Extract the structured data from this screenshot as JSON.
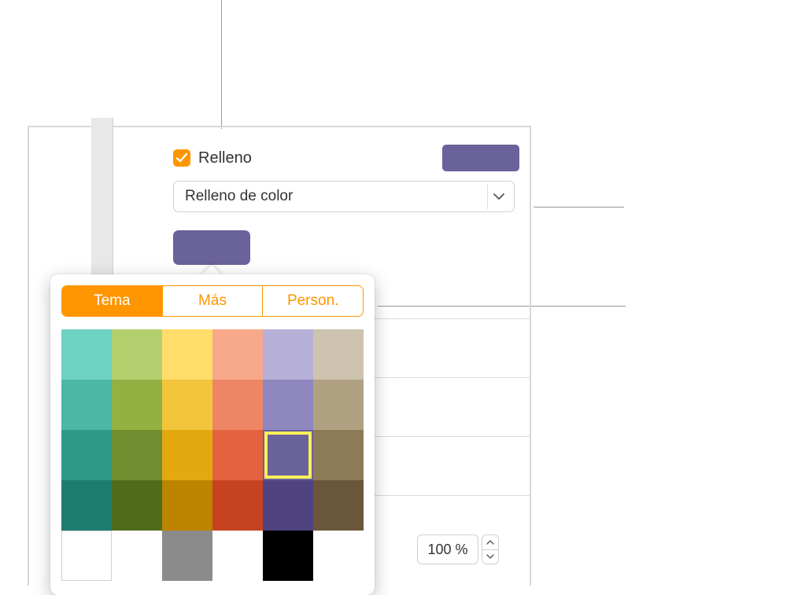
{
  "fill": {
    "checkbox_checked": true,
    "label": "Relleno",
    "preview_color": "#6a629a"
  },
  "dropdown": {
    "selected": "Relleno de color"
  },
  "color_well": {
    "color": "#6a629a"
  },
  "popover": {
    "tabs": {
      "tema": "Tema",
      "mas": "Más",
      "person": "Person.",
      "active": "tema"
    },
    "swatches": [
      [
        "#6fd1c2",
        "#b4cf6e",
        "#ffdd6a",
        "#f7a98a",
        "#b6b0d8",
        "#cdc3af"
      ],
      [
        "#4db7a6",
        "#93b143",
        "#f3c53c",
        "#ee8666",
        "#8f87bf",
        "#b0a183"
      ],
      [
        "#2f9a8a",
        "#6f8e2f",
        "#e3a90f",
        "#e4623f",
        "#6a629a",
        "#8d7a57"
      ],
      [
        "#1e7c6e",
        "#4f6b1c",
        "#bd8400",
        "#c54320",
        "#4f4380",
        "#6a563a"
      ],
      [
        "#ffffff",
        "",
        "#8b8b8b",
        "",
        "#000000",
        ""
      ]
    ],
    "selected": [
      2,
      4
    ]
  },
  "stepper": {
    "value": "100 %"
  }
}
